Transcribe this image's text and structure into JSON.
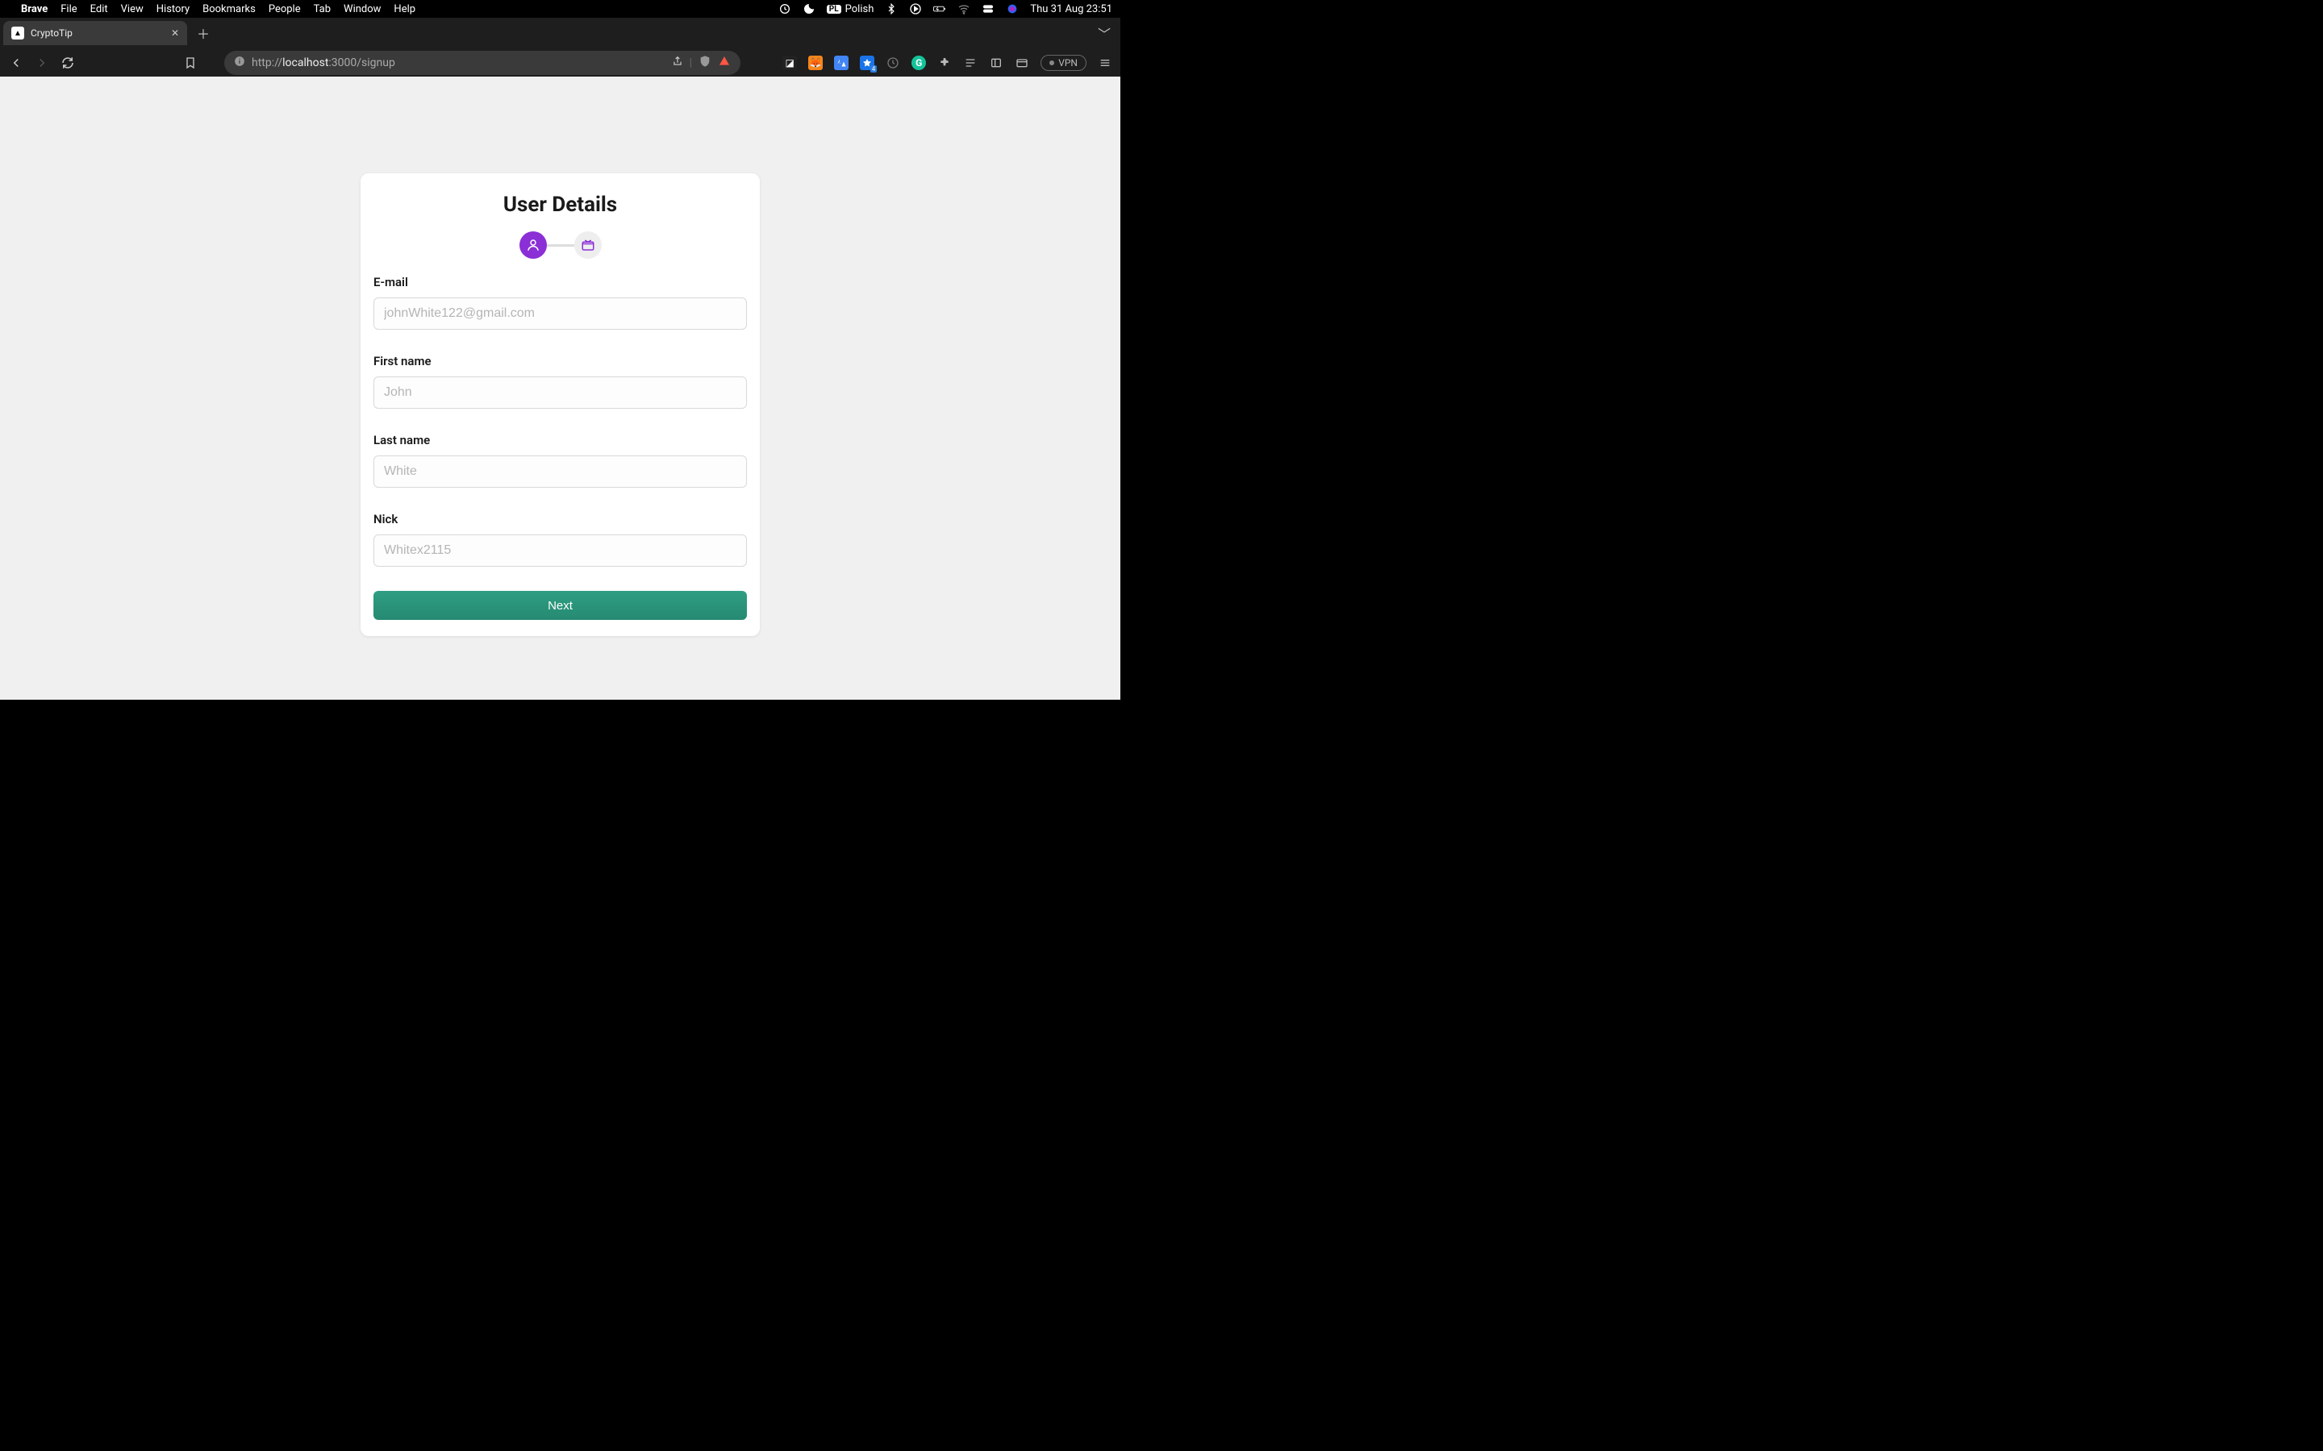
{
  "menubar": {
    "apple": "",
    "app_name": "Brave",
    "items": [
      "File",
      "Edit",
      "View",
      "History",
      "Bookmarks",
      "People",
      "Tab",
      "Window",
      "Help"
    ],
    "lang_code": "PL",
    "lang_label": "Polish",
    "datetime": "Thu 31 Aug  23:51"
  },
  "browser": {
    "tab": {
      "title": "CryptoTip",
      "favicon_glyph": "▲"
    },
    "url": {
      "scheme": "http://",
      "host": "localhost",
      "rest": ":3000/signup"
    },
    "vpn_label": "VPN",
    "ext_badge_count": "4"
  },
  "form": {
    "title": "User Details",
    "fields": {
      "email": {
        "label": "E-mail",
        "placeholder": "johnWhite122@gmail.com"
      },
      "first_name": {
        "label": "First name",
        "placeholder": "John"
      },
      "last_name": {
        "label": "Last name",
        "placeholder": "White"
      },
      "nick": {
        "label": "Nick",
        "placeholder": "Whitex2115"
      }
    },
    "next_label": "Next"
  }
}
